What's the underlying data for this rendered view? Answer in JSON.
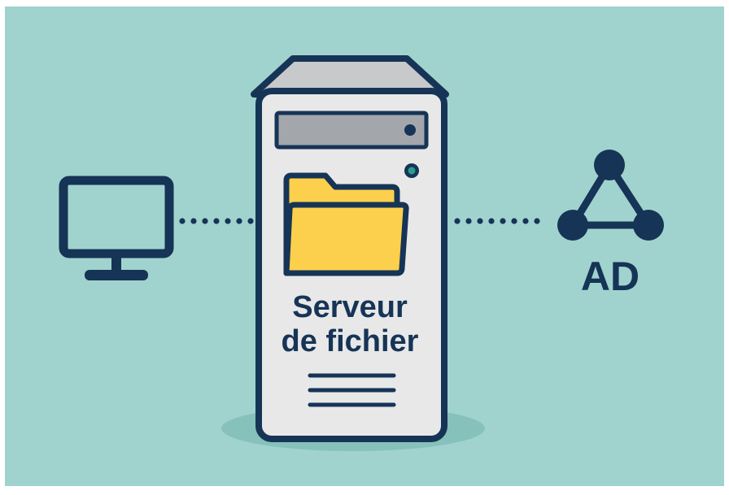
{
  "server": {
    "label_line1": "Serveur",
    "label_line2": "de fichier",
    "status_led_color": "#2a9d8f"
  },
  "ad": {
    "label": "AD"
  },
  "icons": {
    "client": "desktop-monitor-icon",
    "server": "server-tower-icon",
    "folder": "folder-icon",
    "ad": "network-triangle-icon"
  },
  "colors": {
    "background": "#a0d3ce",
    "dark_navy": "#163456",
    "server_body": "#e8e8e8",
    "server_top": "#c8c9cb",
    "drive_bay": "#a3a6ab",
    "folder": "#fcd04c",
    "shadow": "#86c1bb"
  }
}
